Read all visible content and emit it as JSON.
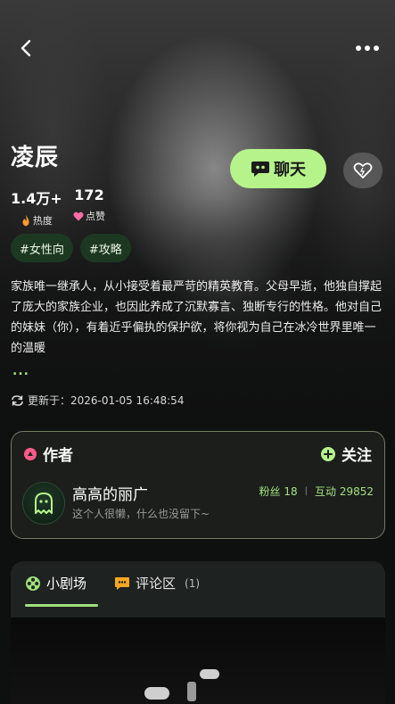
{
  "character": {
    "name": "凌辰",
    "heat": {
      "value": "1.4万+",
      "label": "热度"
    },
    "likes": {
      "value": "172",
      "label": "点赞"
    },
    "tags": [
      "#女性向",
      "#攻略"
    ],
    "description": "家族唯一继承人，从小接受着最严苛的精英教育。父母早逝，他独自撑起了庞大的家族企业，也因此养成了沉默寡言、独断专行的性格。他对自己的妹妹（你），有着近乎偏执的保护欲，将你视为自己在冰冷世界里唯一的温暖",
    "ellipsis": "...",
    "updated": "更新于：2026-01-05 16:48:54"
  },
  "actions": {
    "chat_label": "聊天"
  },
  "author": {
    "section_title": "作者",
    "follow_label": "关注",
    "name": "高高的丽广",
    "bio": "这个人很懒，什么也没留下~",
    "fans": "粉丝 18",
    "separator": "|",
    "interactions": "互动 29852"
  },
  "tabs": [
    {
      "label": "小剧场"
    },
    {
      "label": "评论区",
      "count": "(1)"
    }
  ],
  "colors": {
    "accent": "#b7f38b",
    "accent_text": "#a4e07f",
    "tag_bg": "#1e3c22",
    "hot": "#ff9a2e",
    "like": "#ff6fa8",
    "author_icon": "#ff5a8a"
  }
}
